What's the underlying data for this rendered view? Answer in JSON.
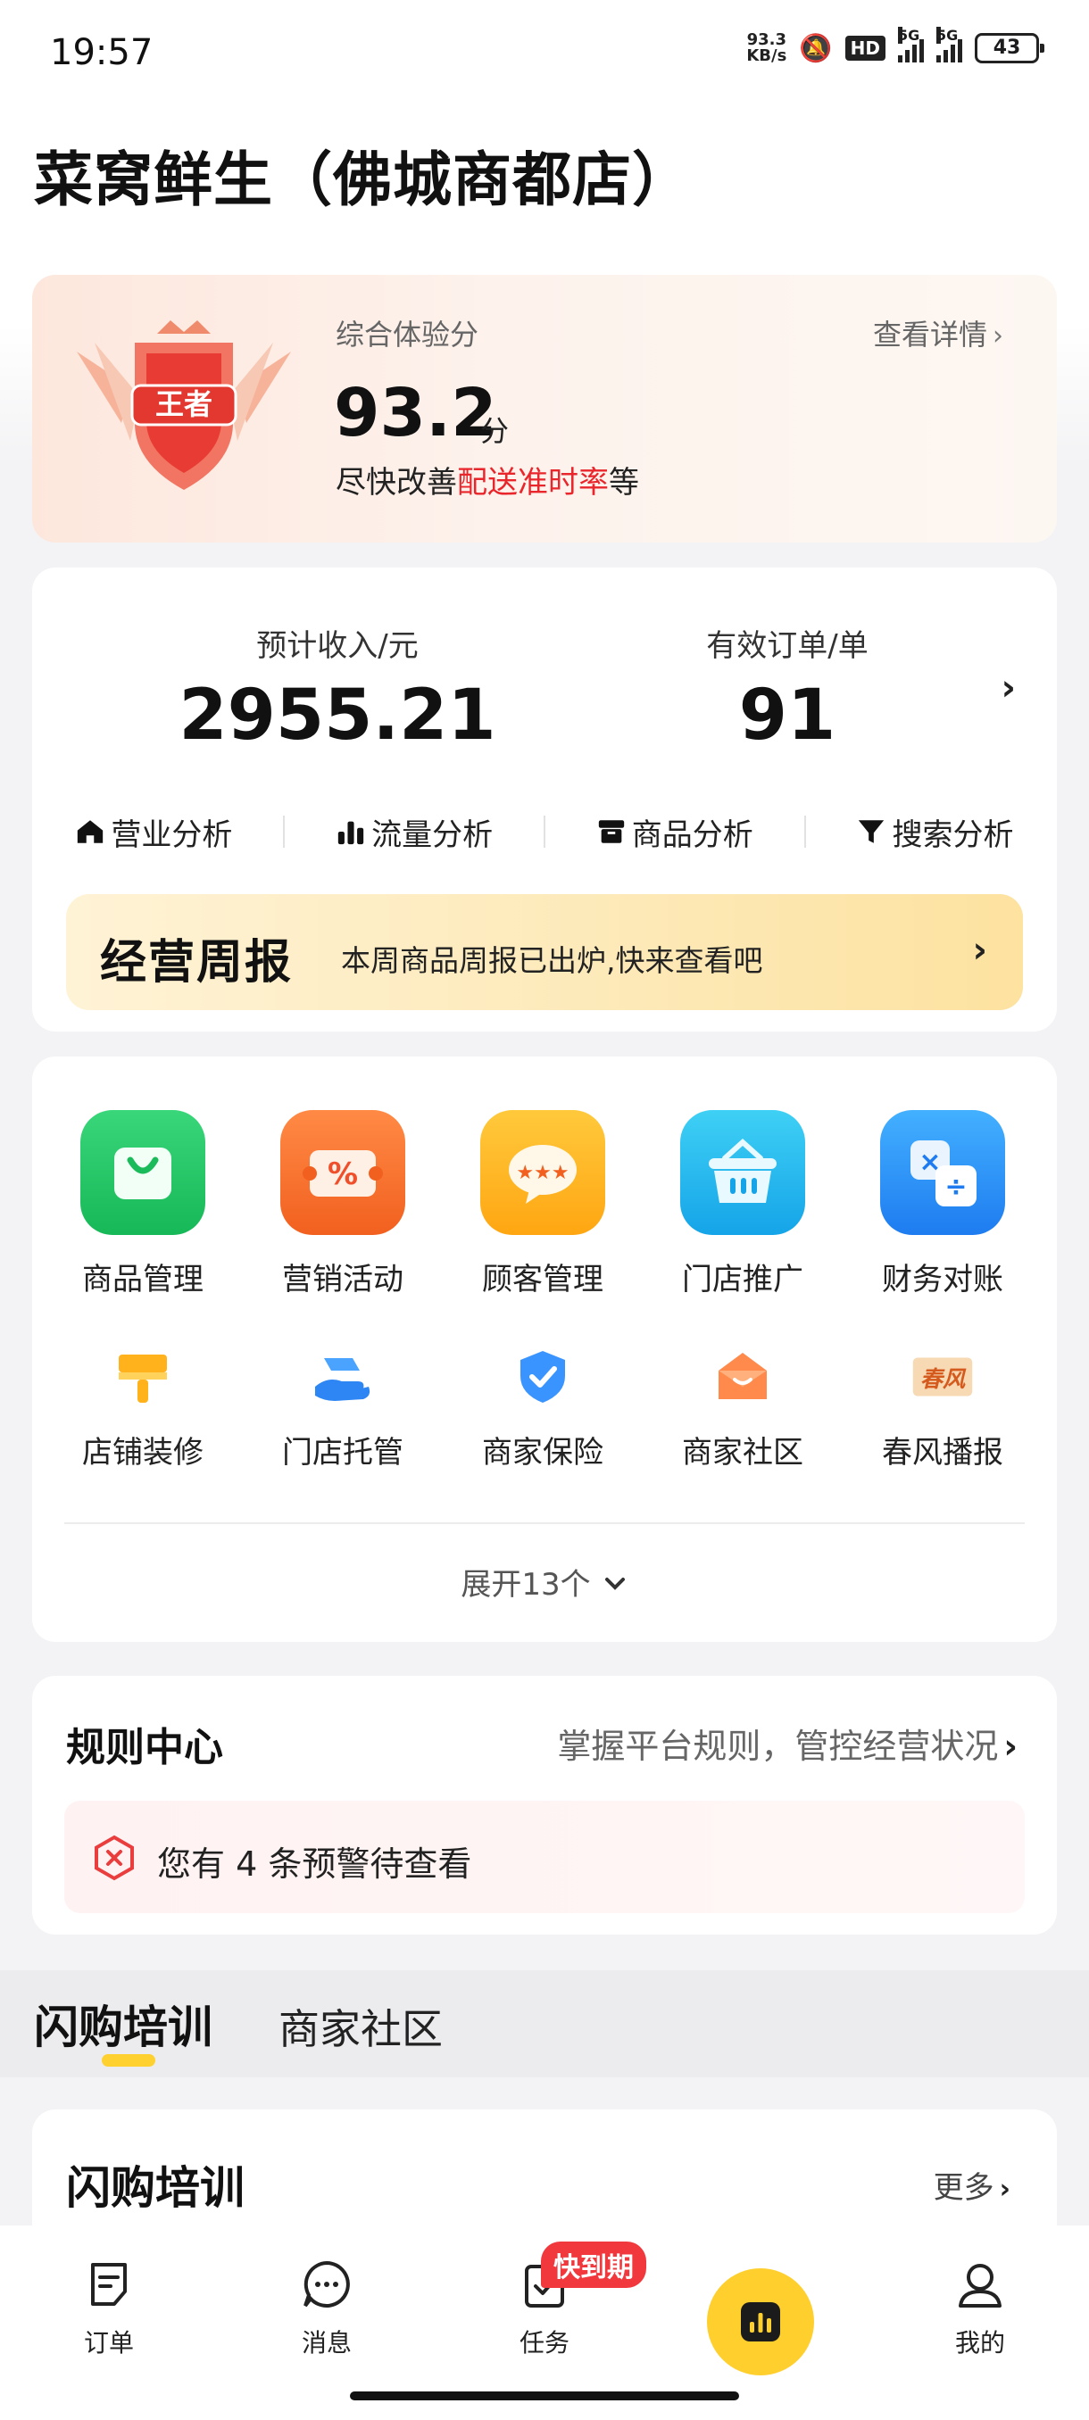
{
  "status_bar": {
    "time": "19:57",
    "net_speed_value": "93.3",
    "net_speed_unit": "KB/s",
    "hd_label": "HD",
    "signal_1": "5G",
    "signal_2": "5G",
    "battery": "43"
  },
  "store": {
    "title": "菜窝鲜生（佛城商都店）"
  },
  "score": {
    "badge_text": "王者",
    "label": "综合体验分",
    "value": "93.2",
    "unit": "分",
    "tip_prefix": "尽快改善",
    "tip_highlight": "配送准时率",
    "tip_suffix": "等",
    "detail_link": "查看详情"
  },
  "stats": {
    "income_label": "预计收入/元",
    "income_value": "2955.21",
    "orders_label": "有效订单/单",
    "orders_value": "91"
  },
  "analysis": [
    {
      "label": "营业分析",
      "icon": "home-icon"
    },
    {
      "label": "流量分析",
      "icon": "bar-chart-icon"
    },
    {
      "label": "商品分析",
      "icon": "box-icon"
    },
    {
      "label": "搜索分析",
      "icon": "funnel-icon"
    }
  ],
  "weekly": {
    "title": "经营周报",
    "text": "本周商品周报已出炉,快来查看吧"
  },
  "tools_primary": [
    {
      "label": "商品管理",
      "icon": "shopping-bag-icon"
    },
    {
      "label": "营销活动",
      "icon": "coupon-icon"
    },
    {
      "label": "顾客管理",
      "icon": "chat-rating-icon"
    },
    {
      "label": "门店推广",
      "icon": "basket-icon"
    },
    {
      "label": "财务对账",
      "icon": "calculator-icon"
    }
  ],
  "tools_secondary": [
    {
      "label": "店铺装修",
      "icon": "paint-brush-icon"
    },
    {
      "label": "门店托管",
      "icon": "hand-care-icon"
    },
    {
      "label": "商家保险",
      "icon": "shield-check-icon"
    },
    {
      "label": "商家社区",
      "icon": "community-icon"
    },
    {
      "label": "春风播报",
      "icon": "broadcast-icon",
      "icon_text": "春风"
    }
  ],
  "expand_label": "展开13个",
  "rules": {
    "title": "规则中心",
    "desc": "掌握平台规则，管控经营状况",
    "warning": "您有 4 条预警待查看"
  },
  "tabs": [
    {
      "label": "闪购培训",
      "active": true
    },
    {
      "label": "商家社区",
      "active": false
    }
  ],
  "training": {
    "title": "闪购培训",
    "more": "更多"
  },
  "bottom_nav": {
    "orders": "订单",
    "messages": "消息",
    "tasks": "任务",
    "tasks_badge": "快到期",
    "mine": "我的"
  },
  "colors": {
    "accent_yellow": "#ffcf2e",
    "alert_red": "#e8262b",
    "badge_red": "#f0383d"
  }
}
